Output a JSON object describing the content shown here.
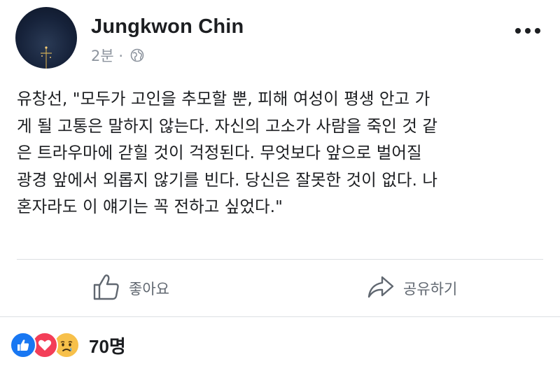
{
  "post": {
    "author": "Jungkwon Chin",
    "timestamp": "2분 ·",
    "privacy_icon": "globe-icon",
    "lines": [
      "유창선, \"모두가 고인을 추모할 뿐, 피해 여성이 평생 안고 가",
      "게 될 고통은 말하지 않는다. 자신의 고소가 사람을 죽인 것 같",
      "은 트라우마에 갇힐 것이 걱정된다. 무엇보다 앞으로 벌어질",
      "광경 앞에서 외롭지 않기를 빈다. 당신은 잘못한 것이 없다. 나",
      "혼자라도 이 얘기는 꼭 전하고 싶었다.\""
    ]
  },
  "actions": {
    "like_label": "좋아요",
    "share_label": "공유하기"
  },
  "reactions": {
    "icons": [
      "like-reaction-icon",
      "love-reaction-icon",
      "sad-reaction-icon"
    ],
    "count": "70명"
  },
  "colors": {
    "text": "#1c1e21",
    "meta": "#8d949e",
    "action": "#606770",
    "like_blue": "#1877f2",
    "love_red": "#f33e58",
    "sad_yellow": "#f7c04a"
  }
}
